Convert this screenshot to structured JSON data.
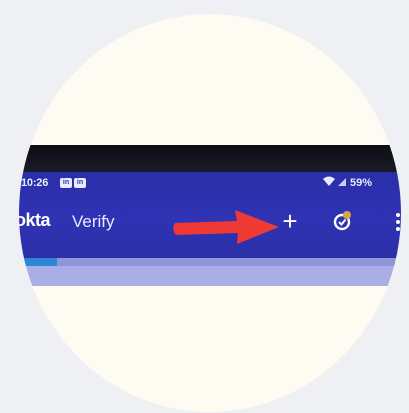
{
  "status_bar": {
    "time": "10:26",
    "notification_icons": [
      "in",
      "in"
    ],
    "wifi_icon": "wifi-icon",
    "signal_icon": "signal-icon",
    "battery": "59%"
  },
  "header": {
    "brand": "okta",
    "app_name": "Verify",
    "add_icon": "plus-icon",
    "add_label": "+",
    "settings_icon": "settings-icon",
    "more_icon": "more-vertical-icon"
  },
  "annotation": {
    "arrow_icon": "arrow-right-icon",
    "color": "#ee3a32"
  },
  "loading": {
    "progress": 0.1
  },
  "colors": {
    "header_bg": "#2f33b4",
    "content_bg": "#aaaee6",
    "progress_fill": "#2d86d6"
  }
}
